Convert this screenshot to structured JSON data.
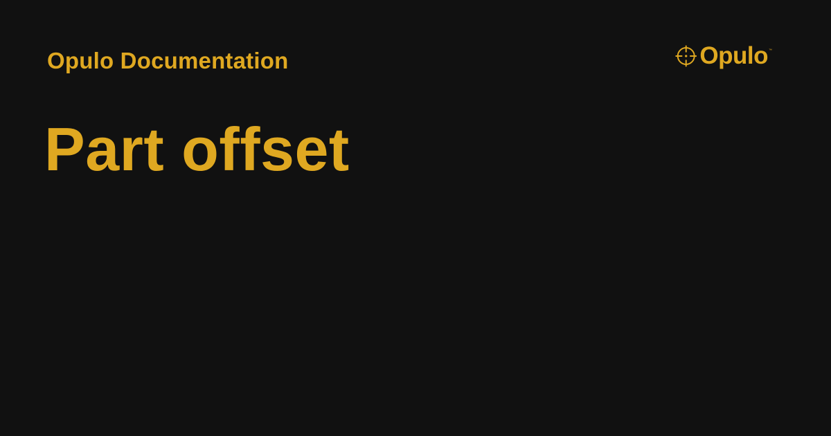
{
  "header": {
    "site_name": "Opulo Documentation"
  },
  "page": {
    "title": "Part offset"
  },
  "logo": {
    "icon": "crosshair-icon",
    "wordmark": "Opulo",
    "trademark": "™"
  },
  "colors": {
    "background": "#111111",
    "accent": "#DFA821"
  }
}
